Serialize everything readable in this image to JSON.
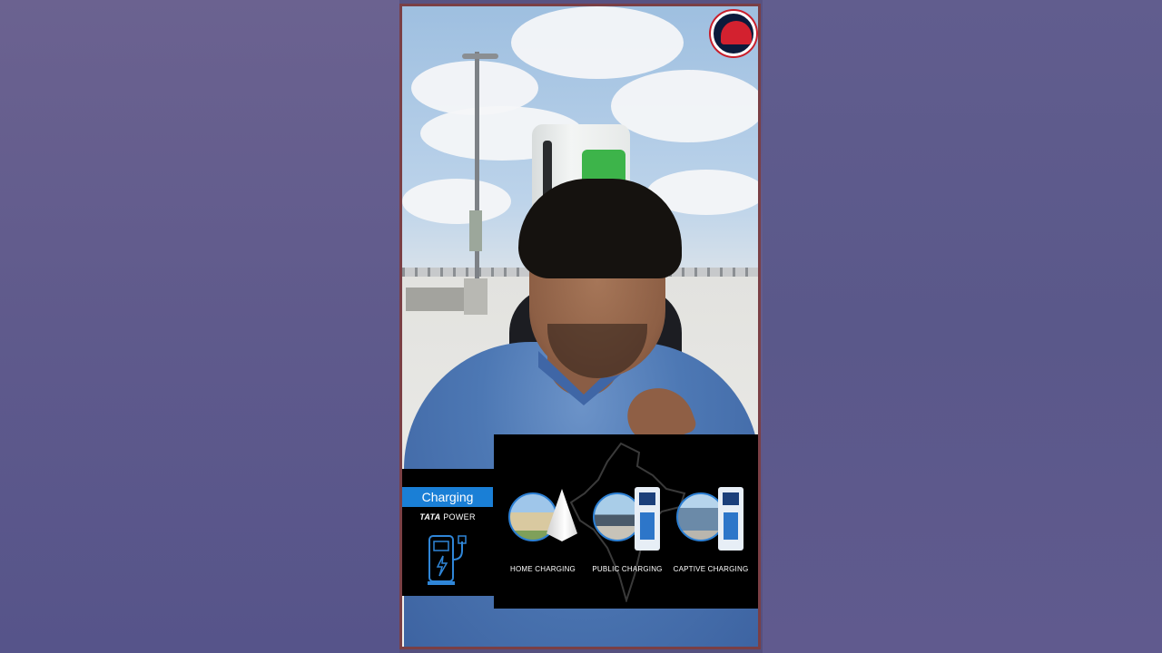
{
  "overlay": {
    "charging_label": "Charging",
    "brand_bold": "TATA",
    "brand_light": "POWER",
    "items": [
      {
        "label": "HOME CHARGING"
      },
      {
        "label": "PUBLIC CHARGING"
      },
      {
        "label": "CAPTIVE CHARGING"
      }
    ]
  },
  "colors": {
    "accent_blue": "#1a7fd6",
    "logo_red": "#d3212f",
    "logo_navy": "#0b1a3b",
    "charger_green": "#3db44a"
  },
  "icons": [
    "channel-logo-icon",
    "ev-charger-icon",
    "india-map-icon",
    "wallbox-charger-icon",
    "charging-kiosk-icon"
  ]
}
